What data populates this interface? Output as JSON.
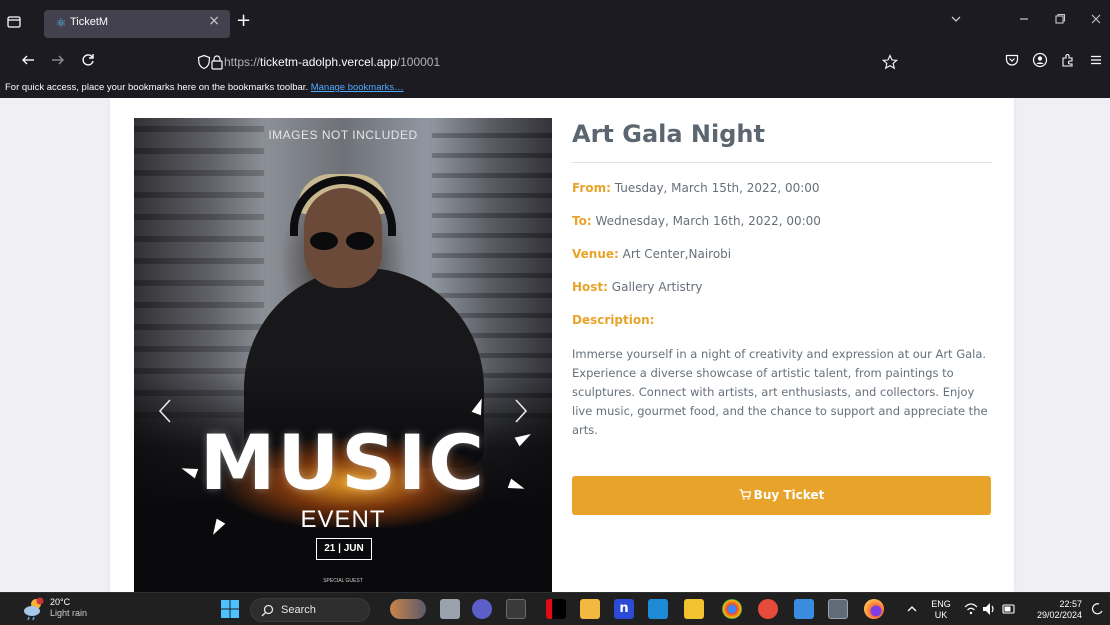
{
  "browser": {
    "tab_title": "TicketM",
    "tab_close": "×",
    "new_tab": "+",
    "url_prefix": "https://",
    "url_host": "ticketm-adolph.vercel.app",
    "url_path": "/100001",
    "bookmarks_hint": "For quick access, place your bookmarks here on the bookmarks toolbar.",
    "bookmarks_link": "Manage bookmarks…"
  },
  "event": {
    "poster": {
      "caption": "IMAGES NOT INCLUDED",
      "headline": "MUSIC",
      "subline": "EVENT",
      "date": "21 | JUN",
      "footer": "SPECIAL GUEST"
    },
    "title": "Art Gala Night",
    "from_label": "From:",
    "from_value": "Tuesday, March 15th, 2022, 00:00",
    "to_label": "To:",
    "to_value": "Wednesday, March 16th, 2022, 00:00",
    "venue_label": "Venue:",
    "venue_value": "Art Center,Nairobi",
    "host_label": "Host:",
    "host_value": "Gallery Artistry",
    "description_label": "Description:",
    "description": "Immerse yourself in a night of creativity and expression at our Art Gala. Experience a diverse showcase of artistic talent, from paintings to sculptures. Connect with artists, art enthusiasts, and collectors. Enjoy live music, gourmet food, and the chance to support and appreciate the arts.",
    "buy_label": "Buy Ticket"
  },
  "taskbar": {
    "weather_temp": "20°C",
    "weather_desc": "Light rain",
    "search_label": "Search",
    "lang_top": "ENG",
    "lang_bottom": "UK",
    "time": "22:57",
    "date": "29/02/2024"
  },
  "colors": {
    "accent": "#e8a42a",
    "chrome": "#1c1b22",
    "taskbar": "#202020"
  }
}
